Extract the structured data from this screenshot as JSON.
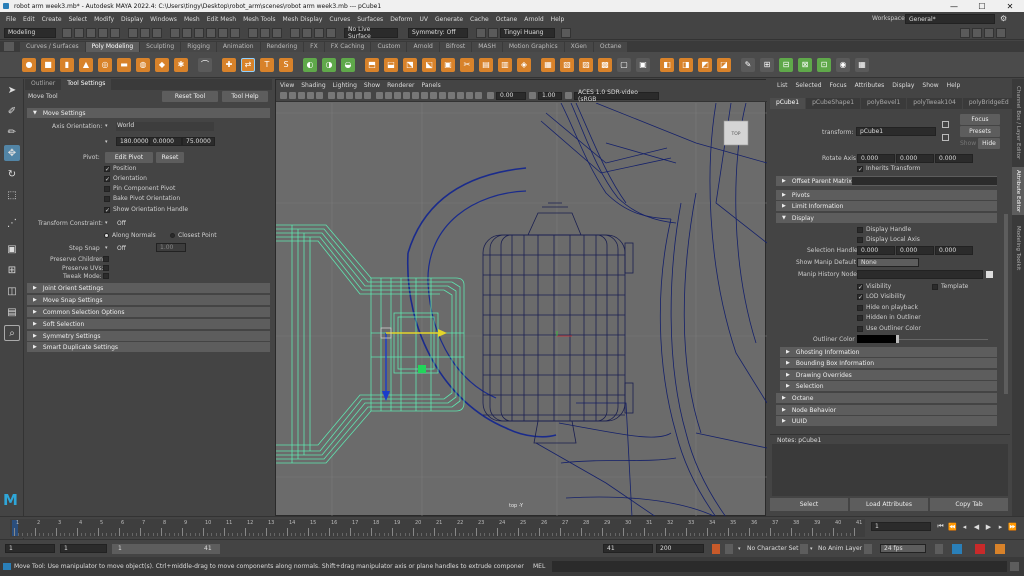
{
  "window": {
    "title": "robot arm week3.mb* - Autodesk MAYA 2022.4: C:\\Users\\tingy\\Desktop\\robot_arm\\scenes\\robot arm week3.mb   ---   pCube1",
    "minimize": "—",
    "maximize": "☐",
    "close": "✕"
  },
  "menubar": [
    "File",
    "Edit",
    "Create",
    "Select",
    "Modify",
    "Display",
    "Windows",
    "Mesh",
    "Edit Mesh",
    "Mesh Tools",
    "Mesh Display",
    "Curves",
    "Surfaces",
    "Deform",
    "UV",
    "Generate",
    "Cache",
    "Octane",
    "Arnold",
    "Help"
  ],
  "workspace": {
    "label": "Workspace :",
    "value": "General*"
  },
  "statusline": {
    "mode": "Modeling",
    "live_surface": "No Live Surface",
    "symmetry": "Symmetry: Off",
    "user": "Tingyi Huang"
  },
  "shelf_tabs": [
    "Curves / Surfaces",
    "Poly Modeling",
    "Sculpting",
    "Rigging",
    "Animation",
    "Rendering",
    "FX",
    "FX Caching",
    "Custom",
    "Arnold",
    "Bifrost",
    "MASH",
    "Motion Graphics",
    "XGen",
    "Octane"
  ],
  "shelf_active": "Poly Modeling",
  "tool_panel": {
    "tabs": [
      "Outliner",
      "Tool Settings"
    ],
    "active_tab": "Tool Settings",
    "tool_name": "Move Tool",
    "reset_tool": "Reset Tool",
    "tool_help": "Tool Help",
    "move_settings": "Move Settings",
    "axis_orientation_label": "Axis Orientation:",
    "axis_orientation": "World",
    "xyz": [
      "180.0000",
      "0.0000",
      "75.0000"
    ],
    "pivot_label": "Pivot:",
    "edit_pivot": "Edit Pivot",
    "reset": "Reset",
    "checks": [
      {
        "label": "Position",
        "checked": true
      },
      {
        "label": "Orientation",
        "checked": true
      },
      {
        "label": "Pin Component Pivot",
        "checked": false
      },
      {
        "label": "Bake Pivot Orientation",
        "checked": false
      },
      {
        "label": "Show Orientation Handle",
        "checked": true
      }
    ],
    "transform_constraint_label": "Transform Constraint:",
    "transform_constraint": "Off",
    "along_normals": "Along Normals",
    "closest_point": "Closest Point",
    "step_snap_label": "Step Snap",
    "step_snap": "Off",
    "step_value": "1.00",
    "preserve_children": "Preserve Children:",
    "preserve_uvs": "Preserve UVs:",
    "tweak_mode": "Tweak Mode:",
    "sections": [
      "Joint Orient Settings",
      "Move Snap Settings",
      "Common Selection Options",
      "Soft Selection",
      "Symmetry Settings",
      "Smart Duplicate Settings"
    ]
  },
  "viewport": {
    "menu": [
      "View",
      "Shading",
      "Lighting",
      "Show",
      "Renderer",
      "Panels"
    ],
    "exposure": "0.00",
    "gamma": "1.00",
    "color_space": "ACES 1.0 SDR-video (sRGB",
    "camera_label": "top -Y",
    "viewcube": "TOP"
  },
  "attr_editor": {
    "menu": [
      "List",
      "Selected",
      "Focus",
      "Attributes",
      "Display",
      "Show",
      "Help"
    ],
    "node_tabs": [
      "pCube1",
      "pCubeShape1",
      "polyBevel1",
      "polyTweak104",
      "polyBridgeEd"
    ],
    "transform_label": "transform:",
    "transform_value": "pCube1",
    "focus": "Focus",
    "presets": "Presets",
    "show": "Show",
    "hide": "Hide",
    "rotate_axis_label": "Rotate Axis",
    "rotate_axis": [
      "0.000",
      "0.000",
      "0.000"
    ],
    "inherits_transform": "Inherits Transform",
    "offset_parent_matrix": "Offset Parent Matrix",
    "pivots": "Pivots",
    "limit_information": "Limit Information",
    "display": "Display",
    "display_handle": "Display Handle",
    "display_local_axis": "Display Local Axis",
    "selection_handle_label": "Selection Handle",
    "selection_handle": [
      "0.000",
      "0.000",
      "0.000"
    ],
    "show_manip_default_label": "Show Manip Default",
    "show_manip_default": "None",
    "manip_history_node_label": "Manip History Node",
    "visibility": "Visibility",
    "template": "Template",
    "lod_visibility": "LOD Visibility",
    "hide_on_playback": "Hide on playback",
    "hidden_in_outliner": "Hidden in Outliner",
    "use_outliner_color": "Use Outliner Color",
    "outliner_color_label": "Outliner Color",
    "subsections": [
      "Ghosting Information",
      "Bounding Box Information",
      "Drawing Overrides",
      "Selection"
    ],
    "top_sections": [
      "Octane",
      "Node Behavior",
      "UUID"
    ],
    "notes_label": "Notes:  pCube1",
    "buttons": [
      "Select",
      "Load Attributes",
      "Copy Tab"
    ]
  },
  "side_tabs": [
    "Channel Box / Layer Editor",
    "Attribute Editor",
    "Modeling Toolkit"
  ],
  "side_tab_active": "Attribute Editor",
  "timeline": {
    "ticks": [
      "1",
      "2",
      "3",
      "4",
      "5",
      "6",
      "7",
      "8",
      "9",
      "10",
      "11",
      "12",
      "13",
      "14",
      "15",
      "16",
      "17",
      "18",
      "19",
      "20",
      "21",
      "22",
      "23",
      "24",
      "25",
      "26",
      "27",
      "28",
      "29",
      "30",
      "31",
      "32",
      "33",
      "34",
      "35",
      "36",
      "37",
      "38",
      "39",
      "40",
      "41"
    ],
    "current_frame": "1"
  },
  "range": {
    "start": "1",
    "playback_start": "1",
    "range_start": "1",
    "range_end": "41",
    "playback_end": "41",
    "end": "200",
    "character_set": "No Character Set",
    "anim_layer": "No Anim Layer",
    "fps": "24 fps"
  },
  "help_line": "Move Tool: Use manipulator to move object(s). Ctrl+middle-drag to move components along normals. Shift+drag manipulator axis or plane handles to extrude components or clone objects. Ctrl+Shift+drag to con",
  "mel_label": "MEL"
}
